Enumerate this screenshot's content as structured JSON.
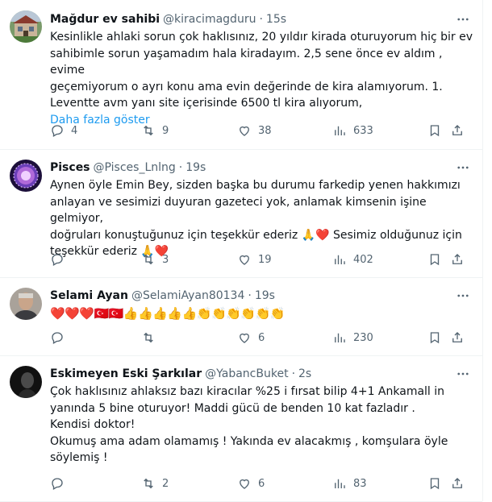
{
  "tweets": [
    {
      "name": "Mağdur ev sahibi",
      "handle": "@kiracimagduru",
      "time": "15s",
      "text": "Kesinlikle ahlaki sorun çok haklısınız, 20 yıldır kirada oturuyorum hiç bir ev\nsahibimle sorun yaşamadım hala kiradayım. 2,5 sene önce ev aldım , evime\ngeçemiyorum o ayrı konu ama evin değerinde de kira alamıyorum. 1.\nLeventte avm yanı site içerisinde 6500 tl kira alıyorum,",
      "show_more": "Daha fazla göster",
      "replies": "4",
      "retweets": "9",
      "likes": "38",
      "views": "633"
    },
    {
      "name": "Pisces",
      "handle": "@Pisces_Lnlng",
      "time": "19s",
      "text": "Aynen öyle Emin Bey, sizden başka bu durumu farkedip yenen hakkımızı\nanlayan ve sesimizi duyuran gazeteci yok, anlamak kimsenin işine gelmiyor,\ndoğruları konuştuğunuz için teşekkür ederiz 🙏❤️ Sesimiz olduğunuz için\nteşekkür ederiz 🙏❤️",
      "replies": "",
      "retweets": "3",
      "likes": "19",
      "views": "402"
    },
    {
      "name": "Selami Ayan",
      "handle": "@SelamiAyan80134",
      "time": "19s",
      "text": "❤️❤️❤️🇹🇷🇹🇷👍👍👍👍👍👏👏👏👏👏👏",
      "replies": "",
      "retweets": "",
      "likes": "6",
      "views": "230"
    },
    {
      "name": "Eskimeyen Eski Şarkılar",
      "handle": "@YabancBuket",
      "time": "2s",
      "text": "Çok haklısınız ahlaksız bazı kiracılar %25 i fırsat bilip 4+1 Ankamall in\nyanında 5 bine oturuyor! Maddi gücü de benden 10 kat fazladır .\nKendisi doktor!\nOkumuş ama adam olamamış ! Yakında  ev alacakmış , komşulara öyle\nsöylemiş !",
      "replies": "",
      "retweets": "2",
      "likes": "6",
      "views": "83"
    }
  ],
  "icons": {
    "more": "more-icon",
    "reply": "reply-icon",
    "retweet": "retweet-icon",
    "like": "heart-icon",
    "views": "views-icon",
    "bookmark": "bookmark-icon",
    "share": "share-icon"
  },
  "colors": {
    "link": "#1d9bf0",
    "secondary": "#536471",
    "text": "#0f1419",
    "divider": "#eff3f4"
  }
}
